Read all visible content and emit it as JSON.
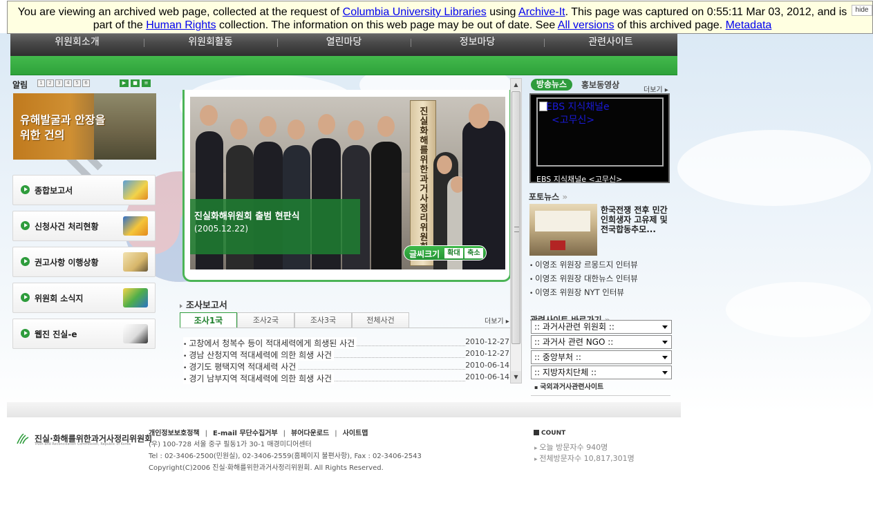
{
  "archive_banner": {
    "text_1": "You are viewing an archived web page, collected at the request of ",
    "link_columbia": "Columbia University Libraries",
    "text_2": " using ",
    "link_archiveit": "Archive-It",
    "text_3": ". This page was captured on 0:55:11 Mar 03, 2012, and is part of the ",
    "link_collection": "Human Rights",
    "text_4": " collection. The information on this web page may be out of date. See ",
    "link_versions": "All versions",
    "text_5": " of this archived page. ",
    "link_metadata": "Metadata",
    "hide_label": "hide"
  },
  "nav": {
    "items": [
      "위원회소개",
      "위원회활동",
      "열린마당",
      "정보마당",
      "관련사이트"
    ]
  },
  "notice": {
    "title": "알림",
    "pages": [
      "1",
      "2",
      "3",
      "4",
      "5",
      "6"
    ],
    "banner_text_1": "유해발굴과 안장을",
    "banner_text_2": "위한 건의"
  },
  "left_menu": [
    {
      "label": "종합보고서",
      "icon": "books-icon"
    },
    {
      "label": "신청사건 처리현황",
      "icon": "pencil-book-icon"
    },
    {
      "label": "권고사항 이행상황",
      "icon": "scroll-icon"
    },
    {
      "label": "위원회 소식지",
      "icon": "chart-icon"
    },
    {
      "label": "웹진 진실-e",
      "icon": "pen-paper-icon"
    }
  ],
  "main_photo": {
    "sign_text": "진실화해를위한과거사정리위원회",
    "caption_title": "진실화해위원회 출범 현판식",
    "caption_date": "(2005.12.22)",
    "font_size_label": "글씨크기",
    "enlarge": "확대",
    "reduce": "축소"
  },
  "reports": {
    "title": "조사보고서",
    "more": "더보기 ▸",
    "tabs": [
      "조사1국",
      "조사2국",
      "조사3국",
      "전체사건"
    ],
    "active_tab": 0,
    "rows": [
      {
        "title": "고창에서 청복수 등이 적대세력에게 희생된 사건",
        "date": "2010-12-27"
      },
      {
        "title": "경남 산청지역 적대세력에 의한 희생 사건",
        "date": "2010-12-27"
      },
      {
        "title": "경기도 평택지역 적대세력 사건",
        "date": "2010-06-14"
      },
      {
        "title": "경기 남부지역 적대세력에 의한 희생 사건",
        "date": "2010-06-14"
      }
    ]
  },
  "broadcast": {
    "tab_active": "방송뉴스",
    "tab_other": "홍보동영상",
    "more": "더보기 ▸",
    "video_title_1": "EBS 지식채널e",
    "video_title_2": "<고무신>",
    "video_caption": "EBS 지식채널e <고무신>"
  },
  "photo_news": {
    "title": "포토뉴스",
    "headline": "한국전쟁 전후 민간인희생자 고유제 및 전국합동추모...",
    "links": [
      "이영조 위원장 르몽드지 인터뷰",
      "이영조 위원장 대한뉴스 인터뷰",
      "이영조 위원장 NYT 인터뷰"
    ]
  },
  "related_sites": {
    "title": "관련사이트 바로가기",
    "selects": [
      ":: 과거사관련 위원회 ::",
      ":: 과거사 관련 NGO ::",
      ":: 중앙부처 ::",
      ":: 지방자치단체 ::"
    ],
    "foreign_link": "국외과거사관련사이트"
  },
  "footer": {
    "org_name": "진실·화해를위한과거사정리위원회",
    "org_name_en": "Truth and Reconciliation Commission, Republic of Korea",
    "links": [
      "개인정보보호정책",
      "E-mail 무단수집거부",
      "뷰어다운로드",
      "사이트맵"
    ],
    "address": "(우) 100-728 서울 중구 필동1가 30-1 매경미디어센터",
    "tel": "Tel : 02-3406-2500(민원실), 02-3406-2559(홈페이지 불편사항), Fax : 02-3406-2543",
    "copyright": "Copyright(C)2006 진실·화해를위한과거사정리위원회. All Rights Reserved.",
    "count_title": "COUNT",
    "today": "오늘 방문자수 940명",
    "total": "전체방문자수 10,817,301명"
  },
  "colors": {
    "brand_green": "#2e9c3c",
    "nav_dark": "#4a4a4a",
    "banner_bg": "#ffffe1"
  }
}
